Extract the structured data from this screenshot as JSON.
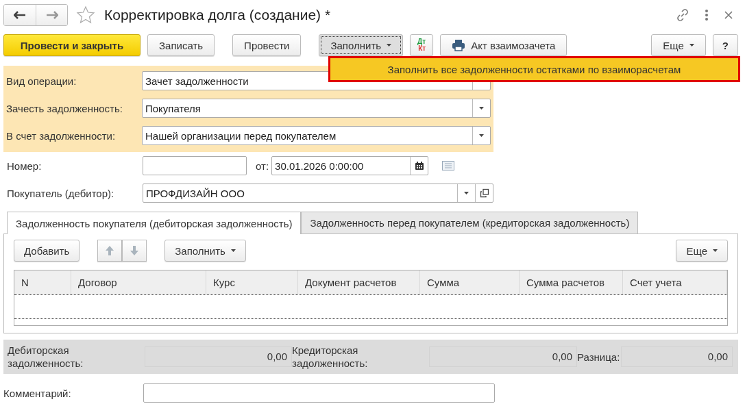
{
  "window": {
    "title": "Корректировка долга (создание) *",
    "favorite": false
  },
  "toolbar": {
    "buttons": [
      {
        "kind": "primary",
        "label": "Провести и закрыть"
      },
      {
        "kind": "plain",
        "label": "Записать"
      },
      {
        "kind": "plain",
        "label": "Провести"
      },
      {
        "kind": "dropdown",
        "label": "Заполнить",
        "expanded": true
      },
      {
        "kind": "dtkt",
        "label": "Дт",
        "label_2": "Кт"
      },
      {
        "kind": "print",
        "label": "Акт взаимозачета"
      },
      {
        "kind": "more",
        "label": "Еще",
        "expanded": false
      },
      {
        "kind": "help",
        "label": "?"
      }
    ]
  },
  "fill_menu": {
    "items": [
      {
        "label": "Заполнить все задолженности остатками по взаиморасчетам",
        "selected": true
      }
    ]
  },
  "operation": {
    "fields": [
      {
        "label": "Вид операции:",
        "value": "Зачет задолженности"
      },
      {
        "label": "Зачесть задолженность:",
        "value": "Покупателя"
      },
      {
        "label": "В счет задолженности:",
        "value": "Нашей организации перед покупателем"
      }
    ]
  },
  "number": {
    "label": "Номер:",
    "date_label": "от:",
    "date": "30.01.2026  0:00:00"
  },
  "buyer": {
    "label": "Покупатель (дебитор):",
    "value": "ПРОФДИЗАЙН ООО"
  },
  "tabs": [
    {
      "label": "Задолженность покупателя (дебиторская задолженность)",
      "selected": true
    },
    {
      "label": "Задолженность перед покупателем (кредиторская задолженность)",
      "selected": false
    }
  ],
  "table_toolbar": {
    "add": "Добавить",
    "fill": "Заполнить",
    "more": "Еще"
  },
  "table": {
    "columns": [
      "N",
      "Договор",
      "Курс",
      "Документ расчетов",
      "Сумма",
      "Сумма расчетов",
      "Счет учета"
    ]
  },
  "totals": [
    {
      "label": "Дебиторская задолженность:",
      "value": "0,00"
    },
    {
      "label": "Кредиторская задолженность:",
      "value": "0,00"
    },
    {
      "label": "Разница:",
      "value": "0,00"
    }
  ],
  "comment": {
    "label": "Комментарий:"
  }
}
